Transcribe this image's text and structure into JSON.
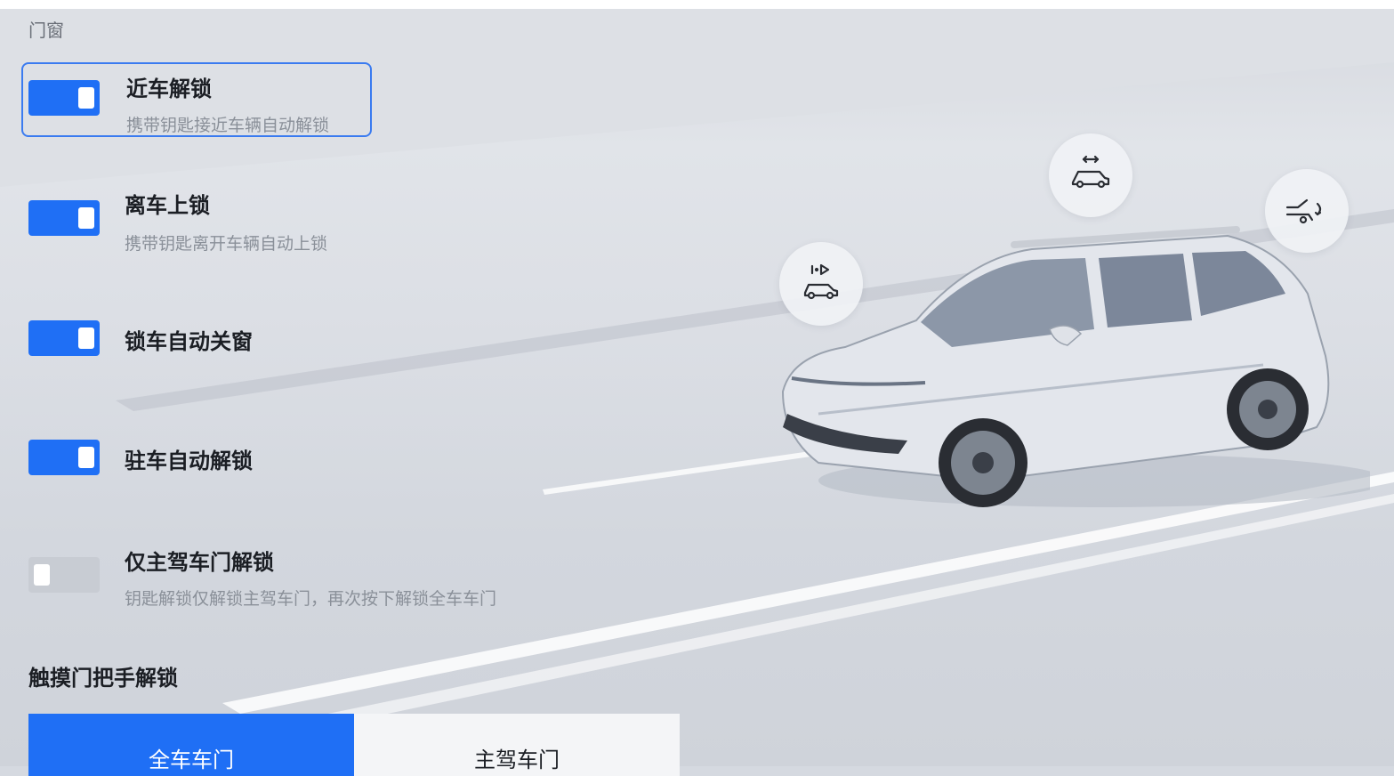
{
  "page": {
    "section_title": "门窗"
  },
  "settings": [
    {
      "title": "近车解锁",
      "desc": "携带钥匙接近车辆自动解锁",
      "enabled": true
    },
    {
      "title": "离车上锁",
      "desc": "携带钥匙离开车辆自动上锁",
      "enabled": true
    },
    {
      "title": "锁车自动关窗",
      "desc": "",
      "enabled": true
    },
    {
      "title": "驻车自动解锁",
      "desc": "",
      "enabled": true
    },
    {
      "title": "仅主驾车门解锁",
      "desc": "钥匙解锁仅解锁主驾车门，再次按下解锁全车车门",
      "enabled": false
    }
  ],
  "touch_handle": {
    "title": "触摸门把手解锁",
    "options": [
      "全车车门",
      "主驾车门"
    ],
    "selected": "全车车门"
  },
  "colors": {
    "accent": "#1f6ff5",
    "toggle_off": "#c8ccd3",
    "background": "#d6d9df"
  },
  "icons": [
    "approach-unlock-icon",
    "window-close-icon",
    "door-unlock-icon"
  ]
}
